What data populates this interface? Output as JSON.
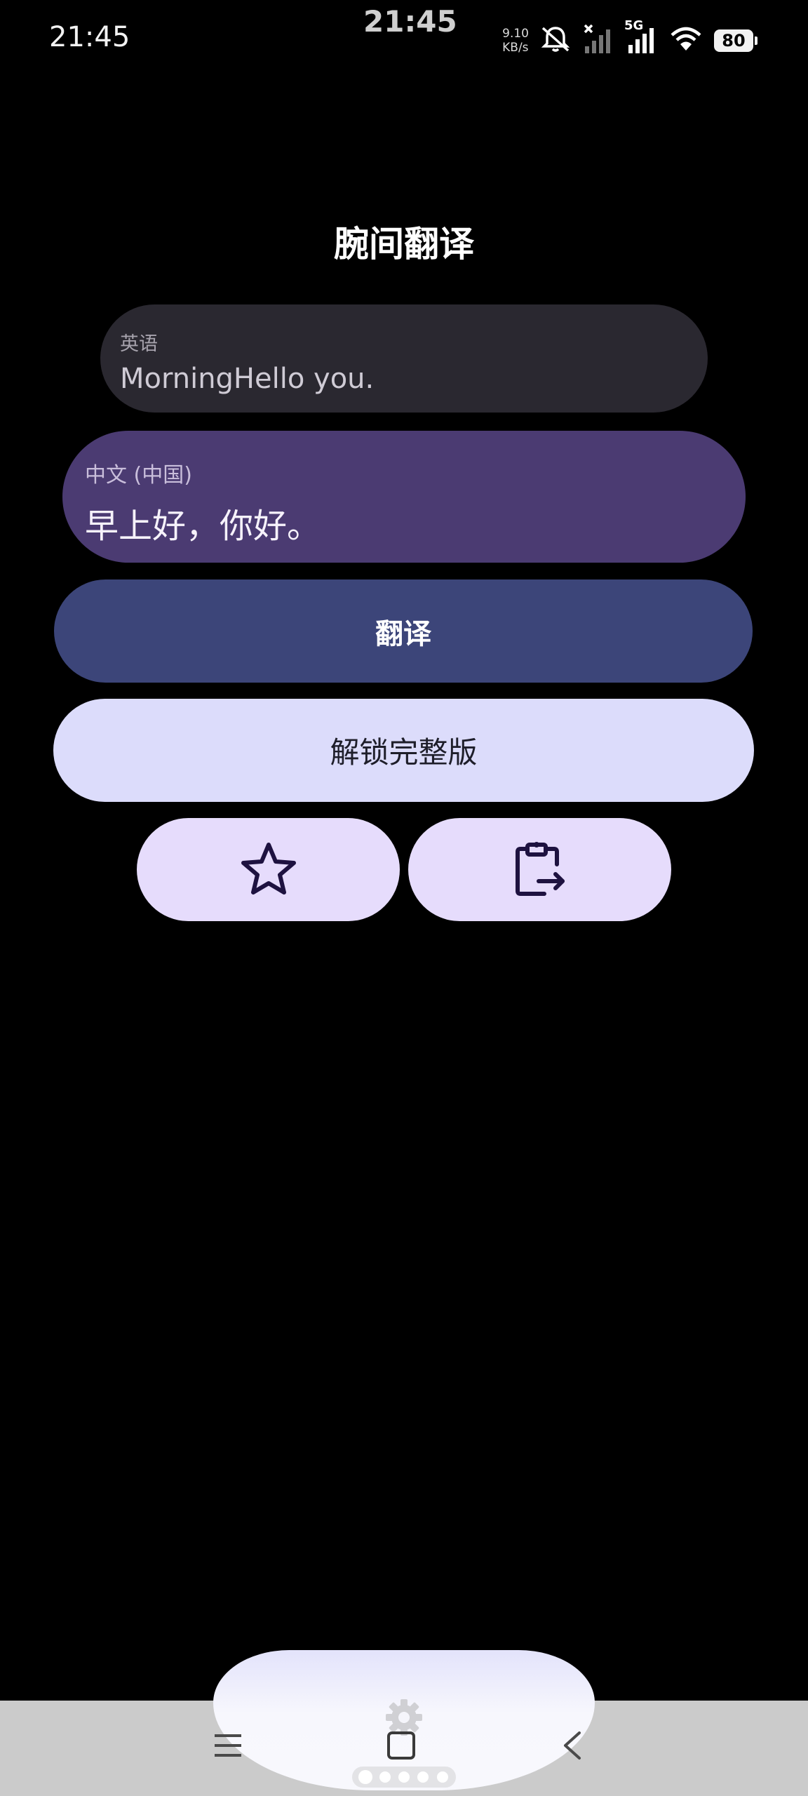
{
  "status_bar": {
    "time": "21:45",
    "center_time": "21:45",
    "net_speed_value": "9.10",
    "net_speed_unit": "KB/s",
    "network_type": "5G",
    "battery": "80",
    "icons": [
      "mute-icon",
      "no-signal-icon",
      "signal-icon",
      "wifi-icon",
      "battery-icon"
    ]
  },
  "app": {
    "title": "腕间翻译"
  },
  "source": {
    "language_label": "英语",
    "text": "MorningHello you."
  },
  "output": {
    "language_label": "中文 (中国)",
    "text": "早上好，你好。"
  },
  "buttons": {
    "translate_label": "翻译",
    "unlock_label": "解锁完整版",
    "favorite_icon": "star-icon",
    "copy_icon": "clipboard-export-icon"
  },
  "nav": {
    "icons": [
      "menu-icon",
      "home-icon",
      "back-icon",
      "settings-icon"
    ],
    "page_count": 5,
    "active_page": 1
  },
  "colors": {
    "background": "#000000",
    "source_card": "#2a2830",
    "output_card": "#4b3b72",
    "translate_button": "#3c4579",
    "unlock_button": "#dcdcfb",
    "icon_button": "#e6dcfc"
  }
}
